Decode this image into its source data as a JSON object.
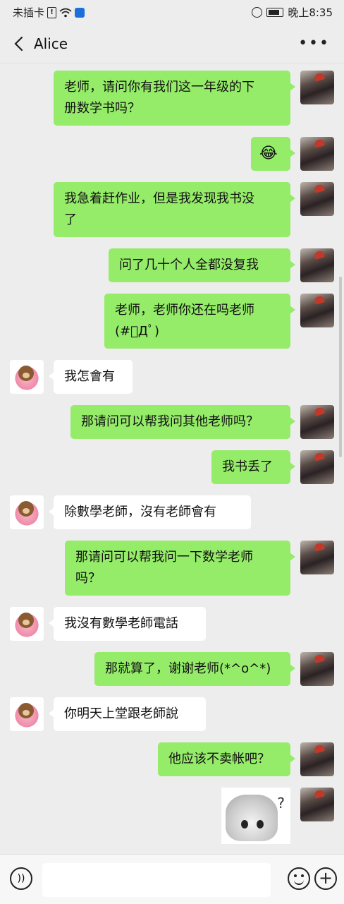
{
  "status_bar": {
    "carrier": "未插卡",
    "time": "晚上8:35"
  },
  "header": {
    "title": "Alice"
  },
  "messages": [
    {
      "side": "me",
      "line1": "老师，请问你有我们这一年级的下",
      "line2": "册数学书吗？"
    },
    {
      "side": "me",
      "text": "😂"
    },
    {
      "side": "me",
      "line1": "我急着赶作业，但是我发现我书没",
      "line2": "了"
    },
    {
      "side": "me",
      "text": "问了几十个人全都没复我"
    },
    {
      "side": "me",
      "line1": "老师，老师你还在吗老师",
      "line2": "(#ﾟДﾟ)"
    },
    {
      "side": "them",
      "text": "我怎會有"
    },
    {
      "side": "me",
      "text": "那请问可以帮我问其他老师吗？"
    },
    {
      "side": "me",
      "text": "我书丢了"
    },
    {
      "side": "them",
      "text": "除數學老師，沒有老師會有"
    },
    {
      "side": "me",
      "line1": "那请问可以帮我问一下数学老师",
      "line2": "吗？"
    },
    {
      "side": "them",
      "text": "我沒有數學老師電話"
    },
    {
      "side": "me",
      "text": "那就算了，谢谢老师(*^o^*)"
    },
    {
      "side": "them",
      "text": "你明天上堂跟老師說"
    },
    {
      "side": "me",
      "text": "他应该不卖帐吧？"
    }
  ],
  "sticker": {
    "mark": "?"
  }
}
